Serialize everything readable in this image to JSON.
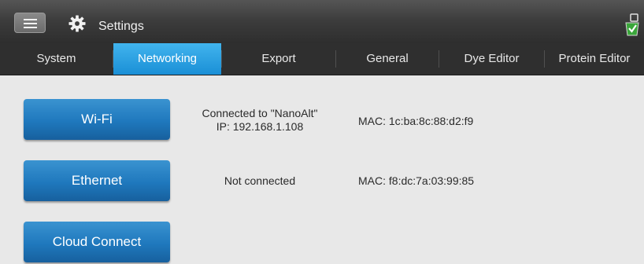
{
  "header": {
    "title": "Settings",
    "menu_icon": "hamburger-menu-icon",
    "settings_icon": "gear-icon",
    "status_icon": "instrument-status-icon"
  },
  "tabs": [
    {
      "label": "System",
      "active": false
    },
    {
      "label": "Networking",
      "active": true
    },
    {
      "label": "Export",
      "active": false
    },
    {
      "label": "General",
      "active": false
    },
    {
      "label": "Dye Editor",
      "active": false
    },
    {
      "label": "Protein Editor",
      "active": false
    }
  ],
  "networking": {
    "wifi": {
      "button_label": "Wi-Fi",
      "status_line1": "Connected to \"NanoAlt\"",
      "status_line2": "IP: 192.168.1.108",
      "mac": "MAC: 1c:ba:8c:88:d2:f9"
    },
    "ethernet": {
      "button_label": "Ethernet",
      "status": "Not connected",
      "mac": "MAC: f8:dc:7a:03:99:85"
    },
    "cloud": {
      "button_label": "Cloud Connect"
    }
  },
  "colors": {
    "accent": "#2a9de3",
    "button_blue": "#1f78bd",
    "titlebar": "#3d3d3d",
    "tabbar": "#2f2f2f",
    "background": "#e8e8e8"
  }
}
